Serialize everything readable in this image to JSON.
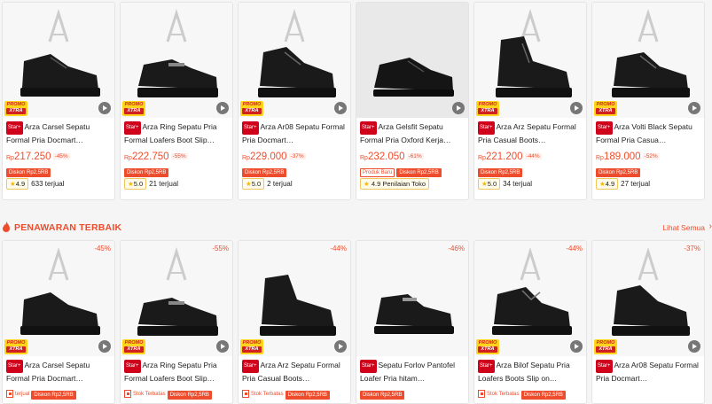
{
  "promo_label_top": "PROMO",
  "promo_label_bottom": "XTRA",
  "star_badge": "Star+",
  "section": {
    "title": "PENAWARAN TERBAIK",
    "see_all": "Lihat Semua"
  },
  "top_products": [
    {
      "title": "Arza Carsel Sepatu Formal Pria Docmart…",
      "currency": "Rp",
      "price": "217.250",
      "discount": "-45%",
      "tags": [
        "Diskon Rp2,5RB"
      ],
      "rating": "4.9",
      "sold": "633 terjual"
    },
    {
      "title": "Arza Ring Sepatu Pria Formal Loafers Boot Slip…",
      "currency": "Rp",
      "price": "222.750",
      "discount": "-55%",
      "tags": [
        "Diskon Rp2,5RB"
      ],
      "rating": "5.0",
      "sold": "21 terjual"
    },
    {
      "title": "Arza Ar08 Sepatu Formal Pria Docmart…",
      "currency": "Rp",
      "price": "229.000",
      "discount": "-37%",
      "tags": [
        "Diskon Rp2,5RB"
      ],
      "rating": "5.0",
      "sold": "2 terjual"
    },
    {
      "title": "Arza Gelsfit Sepatu Formal Pria Oxford Kerja…",
      "currency": "Rp",
      "price": "232.050",
      "discount": "-61%",
      "tags": [
        "Produk Baru",
        "Diskon Rp2,5RB"
      ],
      "rating": "4.9",
      "sold": "Penilaian Toko"
    },
    {
      "title": "Arza Arz Sepatu Formal Pria Casual Boots…",
      "currency": "Rp",
      "price": "221.200",
      "discount": "-44%",
      "tags": [
        "Diskon Rp2,5RB"
      ],
      "rating": "5.0",
      "sold": "34 terjual"
    },
    {
      "title": "Arza Volti Black Sepatu Formal Pria Casua…",
      "currency": "Rp",
      "price": "189.000",
      "discount": "-52%",
      "tags": [
        "Diskon Rp2,5RB"
      ],
      "rating": "4.9",
      "sold": "27 terjual"
    }
  ],
  "bottom_products": [
    {
      "discount": "-45%",
      "title": "Arza Carsel Sepatu Formal Pria Docmart…",
      "mini": "terjual",
      "tag": "Diskon Rp2,5RB"
    },
    {
      "discount": "-55%",
      "title": "Arza Ring Sepatu Pria Formal Loafers Boot Slip…",
      "mini": "Stok Terbatas",
      "tag": "Diskon Rp2,5RB"
    },
    {
      "discount": "-44%",
      "title": "Arza Arz Sepatu Formal Pria Casual Boots…",
      "mini": "Stok Terbatas",
      "tag": "Diskon Rp2,5RB"
    },
    {
      "discount": "-46%",
      "title": "Sepatu Forlov Pantofel Loafer Pria hitam…",
      "mini": "",
      "tag": "Diskon Rp2,5RB"
    },
    {
      "discount": "-44%",
      "title": "Arza Bilof Sepatu Pria Loafers Boots Slip on…",
      "mini": "Stok Terbatas",
      "tag": "Diskon Rp2,5RB"
    },
    {
      "discount": "-37%",
      "title": "Arza Ar08 Sepatu Formal Pria Docmart…",
      "mini": "",
      "tag": "Diskon Rp2,5RB"
    }
  ],
  "colors": {
    "accent": "#ee4d2d",
    "promo_yellow": "#ffd51c",
    "star_badge": "#d0011b",
    "rating_star": "#f5b800"
  }
}
